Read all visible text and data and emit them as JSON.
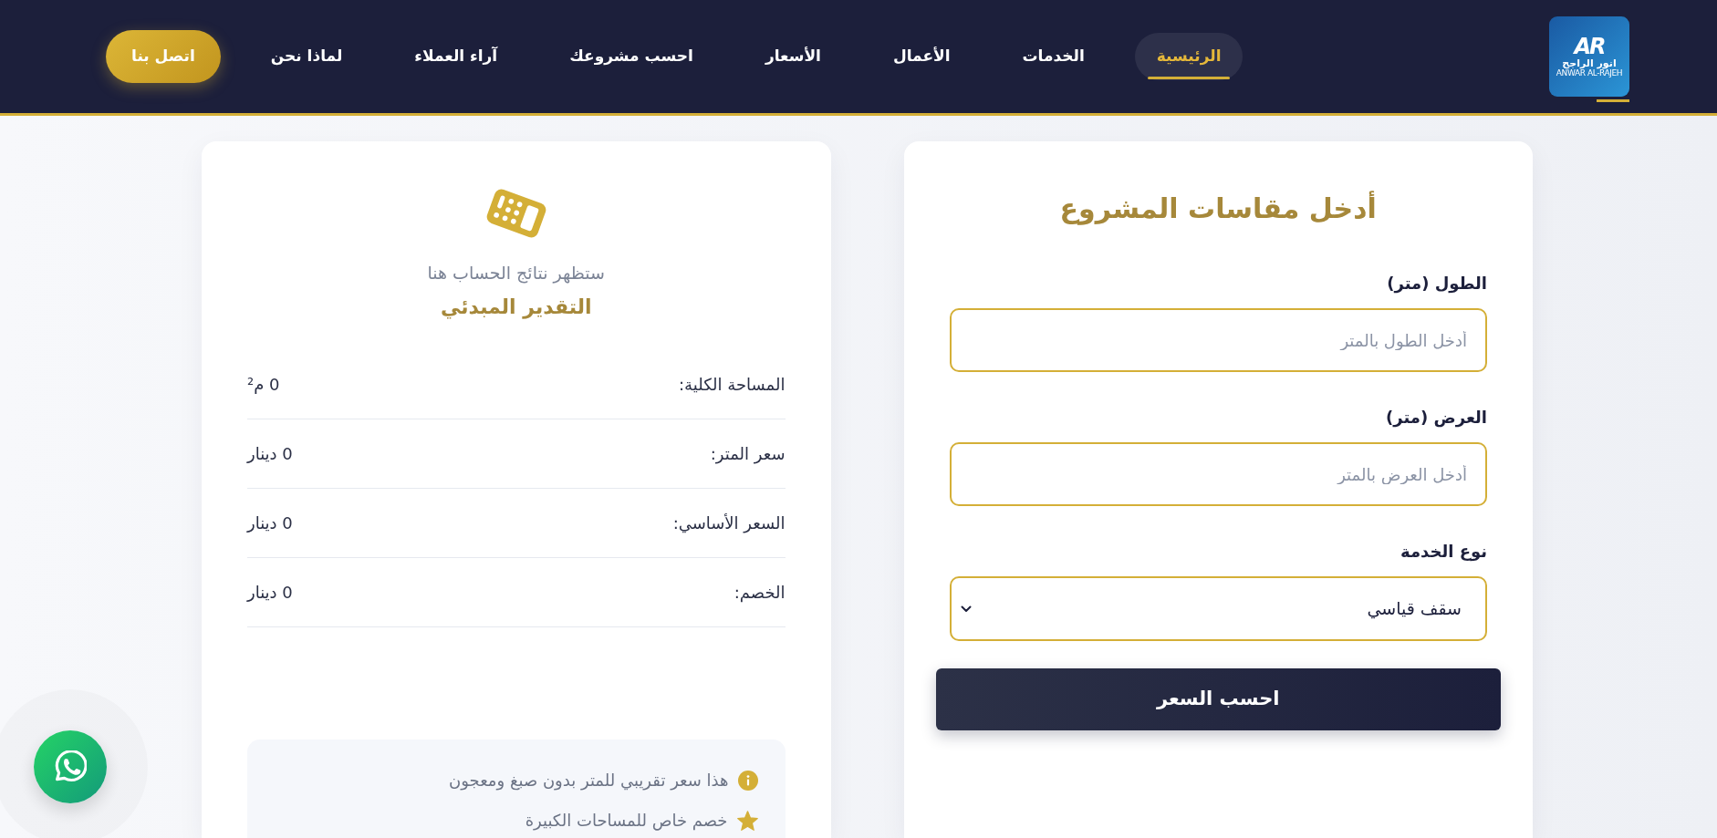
{
  "navbar": {
    "logo": {
      "letters": "AR",
      "name_ar": "انور الراجح",
      "name_en": "ANWAR AL-RAJEH"
    },
    "links": [
      {
        "label": "الرئيسية",
        "selected": true
      },
      {
        "label": "الخدمات",
        "selected": false
      },
      {
        "label": "الأعمال",
        "selected": false
      },
      {
        "label": "الأسعار",
        "selected": false
      },
      {
        "label": "احسب مشروعك",
        "selected": false
      },
      {
        "label": "آراء العملاء",
        "selected": false
      },
      {
        "label": "لماذا نحن",
        "selected": false
      }
    ],
    "contact_button": "اتصل بنا"
  },
  "form_card": {
    "title": "أدخل مقاسات المشروع",
    "fields": [
      {
        "kind": "input",
        "label": "الطول (متر)",
        "placeholder": "أدخل الطول بالمتر"
      },
      {
        "kind": "input",
        "label": "العرض (متر)",
        "placeholder": "أدخل العرض بالمتر"
      },
      {
        "kind": "select",
        "label": "نوع الخدمة",
        "value": "سقف قياسي"
      }
    ],
    "submit_button": "احسب السعر"
  },
  "results_card": {
    "hint": "ستظهر نتائج الحساب هنا",
    "title": "التقدير المبدئي",
    "rows": [
      {
        "label": "المساحة الكلية:",
        "value": "0 م²"
      },
      {
        "label": "سعر المتر:",
        "value": "0 دينار"
      },
      {
        "label": "السعر الأساسي:",
        "value": "0 دينار"
      },
      {
        "label": "الخصم:",
        "value": "0 دينار"
      }
    ],
    "notes": [
      {
        "kind": "info",
        "text": "هذا سعر تقريبي للمتر بدون صبغ ومعجون"
      },
      {
        "kind": "star",
        "text": "خصم خاص للمساحات الكبيرة"
      }
    ]
  }
}
